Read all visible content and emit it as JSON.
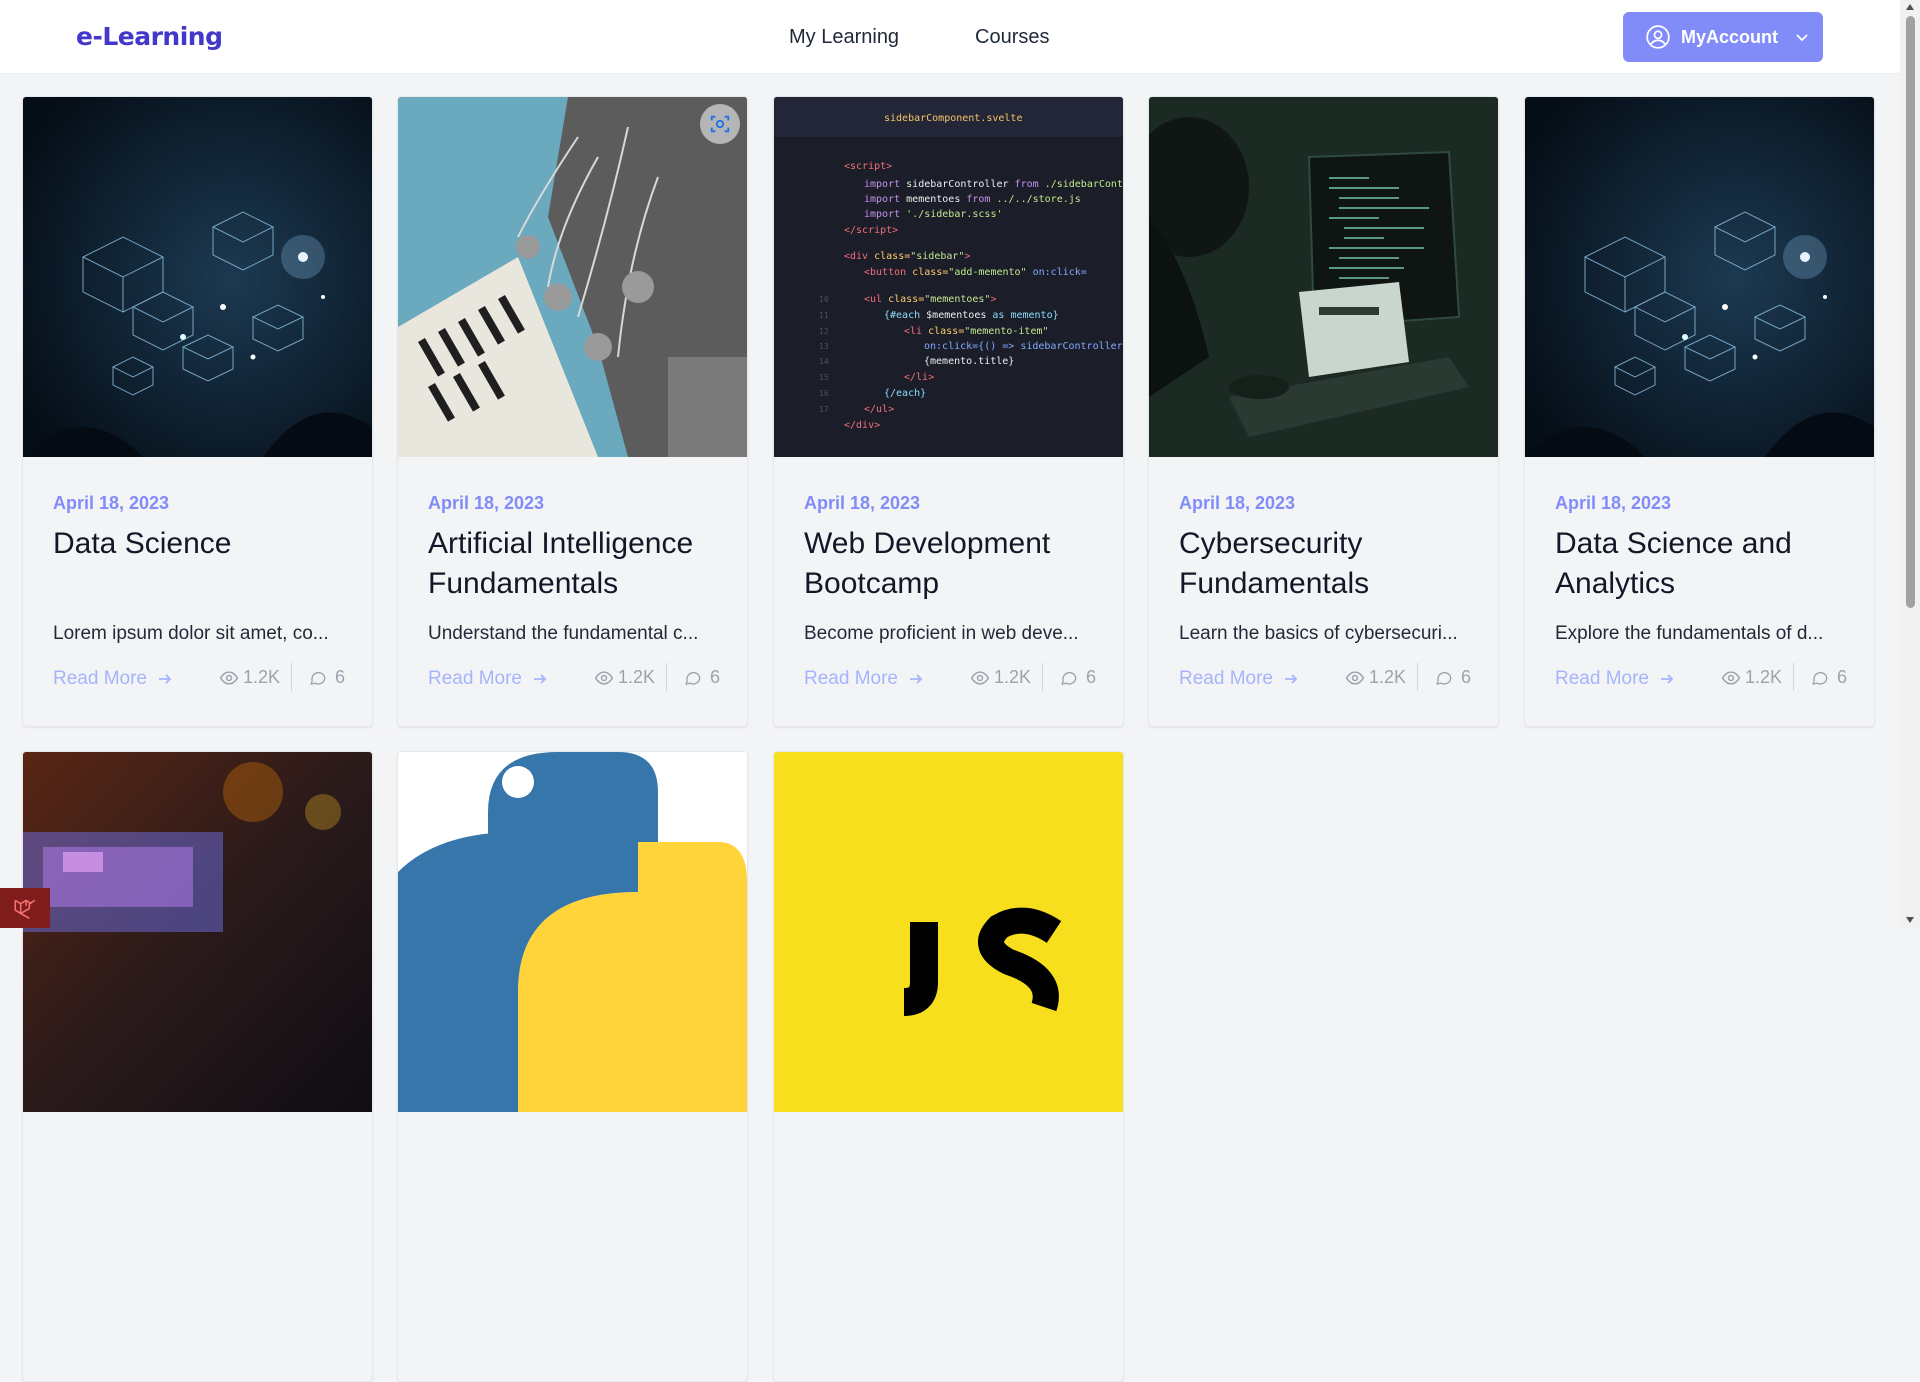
{
  "nav": {
    "brand": "e-Learning",
    "links": [
      "My Learning",
      "Courses"
    ],
    "account_label": "MyAccount"
  },
  "courses": [
    {
      "date": "April 18, 2023",
      "title": "Data Science",
      "desc": "Lorem ipsum dolor sit amet, co...",
      "read_more": "Read More",
      "views": "1.2K",
      "comments": "6",
      "image": "network-cubes"
    },
    {
      "date": "April 18, 2023",
      "title": "Artificial Intelligence Fundamentals",
      "desc": "Understand the fundamental c...",
      "read_more": "Read More",
      "views": "1.2K",
      "comments": "6",
      "image": "robot-piano"
    },
    {
      "date": "April 18, 2023",
      "title": "Web Development Bootcamp",
      "desc": "Become proficient in web deve...",
      "read_more": "Read More",
      "views": "1.2K",
      "comments": "6",
      "image": "code-editor"
    },
    {
      "date": "April 18, 2023",
      "title": "Cybersecurity Fundamentals",
      "desc": "Learn the basics of cybersecuri...",
      "read_more": "Read More",
      "views": "1.2K",
      "comments": "6",
      "image": "hacker-laptop"
    },
    {
      "date": "April 18, 2023",
      "title": "Data Science and Analytics",
      "desc": "Explore the fundamentals of d...",
      "read_more": "Read More",
      "views": "1.2K",
      "comments": "6",
      "image": "network-cubes"
    },
    {
      "image": "blurred-screens"
    },
    {
      "image": "python-logo"
    },
    {
      "image": "js-logo"
    }
  ]
}
